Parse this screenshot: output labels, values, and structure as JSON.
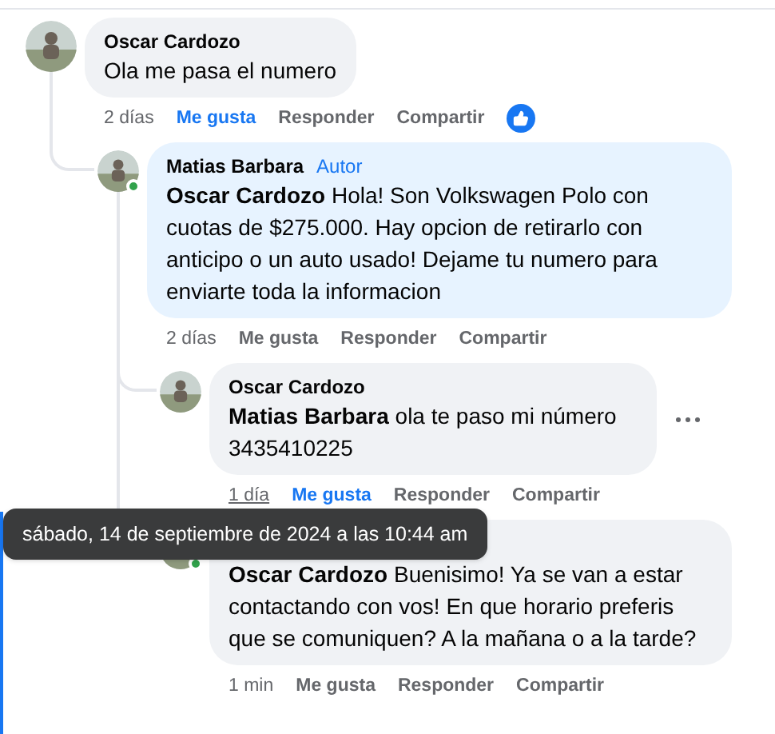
{
  "comments": [
    {
      "author": "Oscar Cardozo",
      "body": "Ola me pasa el numero",
      "time": "2 días",
      "like": "Me gusta",
      "reply": "Responder",
      "share": "Compartir",
      "liked": true,
      "reacted": true,
      "online": false,
      "time_hovered": false,
      "show_menu": false,
      "children": [
        {
          "author": "Matias Barbara",
          "badge": "Autor",
          "body": "**Oscar Cardozo** Hola! Son Volkswagen Polo con cuotas de $275.000. Hay opcion de retirarlo con anticipo o un auto usado! Dejame tu numero para enviarte toda la informacion",
          "time": "2 días",
          "like": "Me gusta",
          "reply": "Responder",
          "share": "Compartir",
          "liked": false,
          "reacted": false,
          "online": true,
          "time_hovered": false,
          "show_menu": false,
          "children": [
            {
              "author": "Oscar Cardozo",
              "body": "**Matias Barbara** ola te paso mi número 3435410225",
              "time": "1 día",
              "like": "Me gusta",
              "reply": "Responder",
              "share": "Compartir",
              "liked": true,
              "reacted": false,
              "online": false,
              "time_hovered": true,
              "show_menu": true
            },
            {
              "body": "**Oscar Cardozo** Buenisimo! Ya se van a estar contactando con vos! En que horario preferis que se comuniquen? A la mañana o a la tarde?",
              "time": "1 min",
              "like": "Me gusta",
              "reply": "Responder",
              "share": "Compartir",
              "liked": false,
              "reacted": false,
              "online": true,
              "time_hovered": false,
              "show_menu": false
            }
          ]
        }
      ]
    }
  ],
  "tooltip": {
    "text": "sábado, 14 de septiembre de 2024 a las 10:44 am"
  }
}
